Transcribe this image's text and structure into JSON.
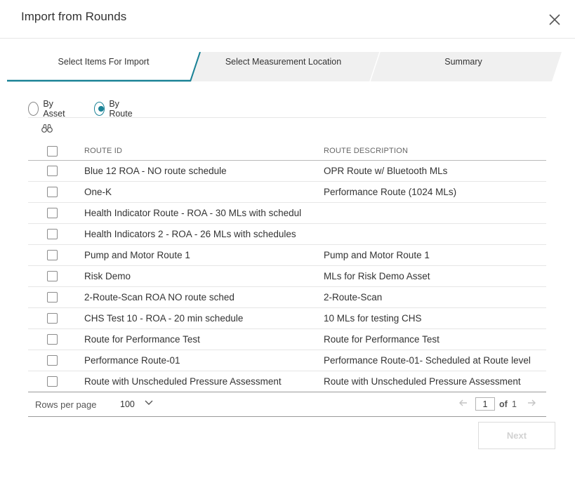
{
  "dialog": {
    "title": "Import from Rounds"
  },
  "steps": [
    {
      "label": "Select Items For Import",
      "active": true
    },
    {
      "label": "Select Measurement Location",
      "active": false
    },
    {
      "label": "Summary",
      "active": false
    }
  ],
  "mode": {
    "options": [
      {
        "label": "By Asset",
        "selected": false
      },
      {
        "label": "By Route",
        "selected": true
      }
    ]
  },
  "table": {
    "headers": {
      "route_id": "ROUTE ID",
      "route_description": "ROUTE DESCRIPTION"
    },
    "rows": [
      {
        "id": "Blue 12 ROA - NO route schedule",
        "desc": "OPR Route w/ Bluetooth MLs"
      },
      {
        "id": "One-K",
        "desc": "Performance Route (1024 MLs)"
      },
      {
        "id": "Health Indicator Route - ROA - 30 MLs with schedul",
        "desc": ""
      },
      {
        "id": "Health Indicators 2 - ROA - 26 MLs with schedules",
        "desc": ""
      },
      {
        "id": "Pump and Motor Route 1",
        "desc": "Pump and Motor Route 1"
      },
      {
        "id": "Risk Demo",
        "desc": "MLs for Risk Demo Asset"
      },
      {
        "id": "2-Route-Scan ROA NO route sched",
        "desc": "2-Route-Scan"
      },
      {
        "id": "CHS Test 10 - ROA - 20 min schedule",
        "desc": "10 MLs for testing CHS"
      },
      {
        "id": "Route for Performance Test",
        "desc": "Route for Performance Test"
      },
      {
        "id": "Performance Route-01",
        "desc": "Performance Route-01- Scheduled at Route level"
      },
      {
        "id": "Route with Unscheduled Pressure Assessment",
        "desc": "Route with Unscheduled Pressure Assessment"
      }
    ]
  },
  "pager": {
    "rows_per_page_label": "Rows per page",
    "rows_per_page_value": "100",
    "current_page": "1",
    "of_label": "of",
    "total_pages": "1"
  },
  "actions": {
    "next_label": "Next"
  },
  "colors": {
    "accent": "#1a8296",
    "inactive_step": "#f0f0f0",
    "disabled_text": "#d2d2d2"
  }
}
